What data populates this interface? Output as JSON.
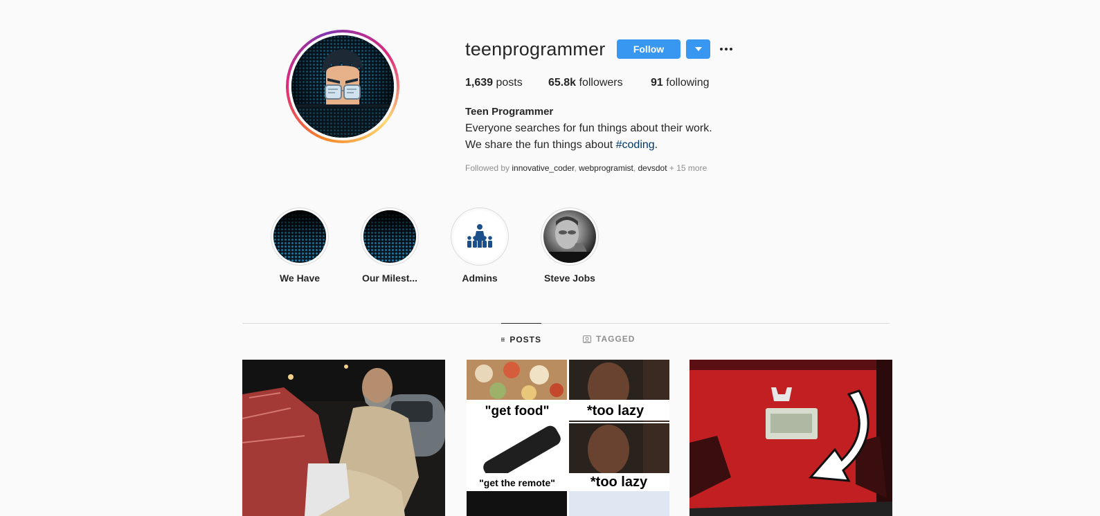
{
  "profile": {
    "username": "teenprogrammer",
    "follow_label": "Follow",
    "stats": {
      "posts_count": "1,639",
      "posts_label": "posts",
      "followers_count": "65.8k",
      "followers_label": "followers",
      "following_count": "91",
      "following_label": "following"
    },
    "full_name": "Teen Programmer",
    "bio_line1": "Everyone searches for fun things about their work.",
    "bio_line2_prefix": "We share the fun things about ",
    "bio_hashtag": "#coding",
    "bio_line2_suffix": ".",
    "followed_by": {
      "prefix": "Followed by ",
      "accounts": [
        "innovative_coder",
        "webprogramist",
        "devsdot"
      ],
      "more": "+ 15 more"
    }
  },
  "highlights": [
    {
      "label": "We Have"
    },
    {
      "label": "Our Milest..."
    },
    {
      "label": "Admins"
    },
    {
      "label": "Steve Jobs"
    }
  ],
  "tabs": [
    {
      "label": "POSTS",
      "active": true
    },
    {
      "label": "TAGGED",
      "active": false
    }
  ],
  "posts": [
    {
      "caption_text": []
    },
    {
      "caption_text": [
        "\"get food\"",
        "*too lazy",
        "\"get the remote\"",
        "*too lazy"
      ]
    },
    {
      "caption_text": []
    }
  ],
  "colors": {
    "accent": "#3897f0",
    "hashtag": "#00376b",
    "text": "#262626",
    "muted": "#8e8e8e",
    "background": "#fafafa"
  }
}
